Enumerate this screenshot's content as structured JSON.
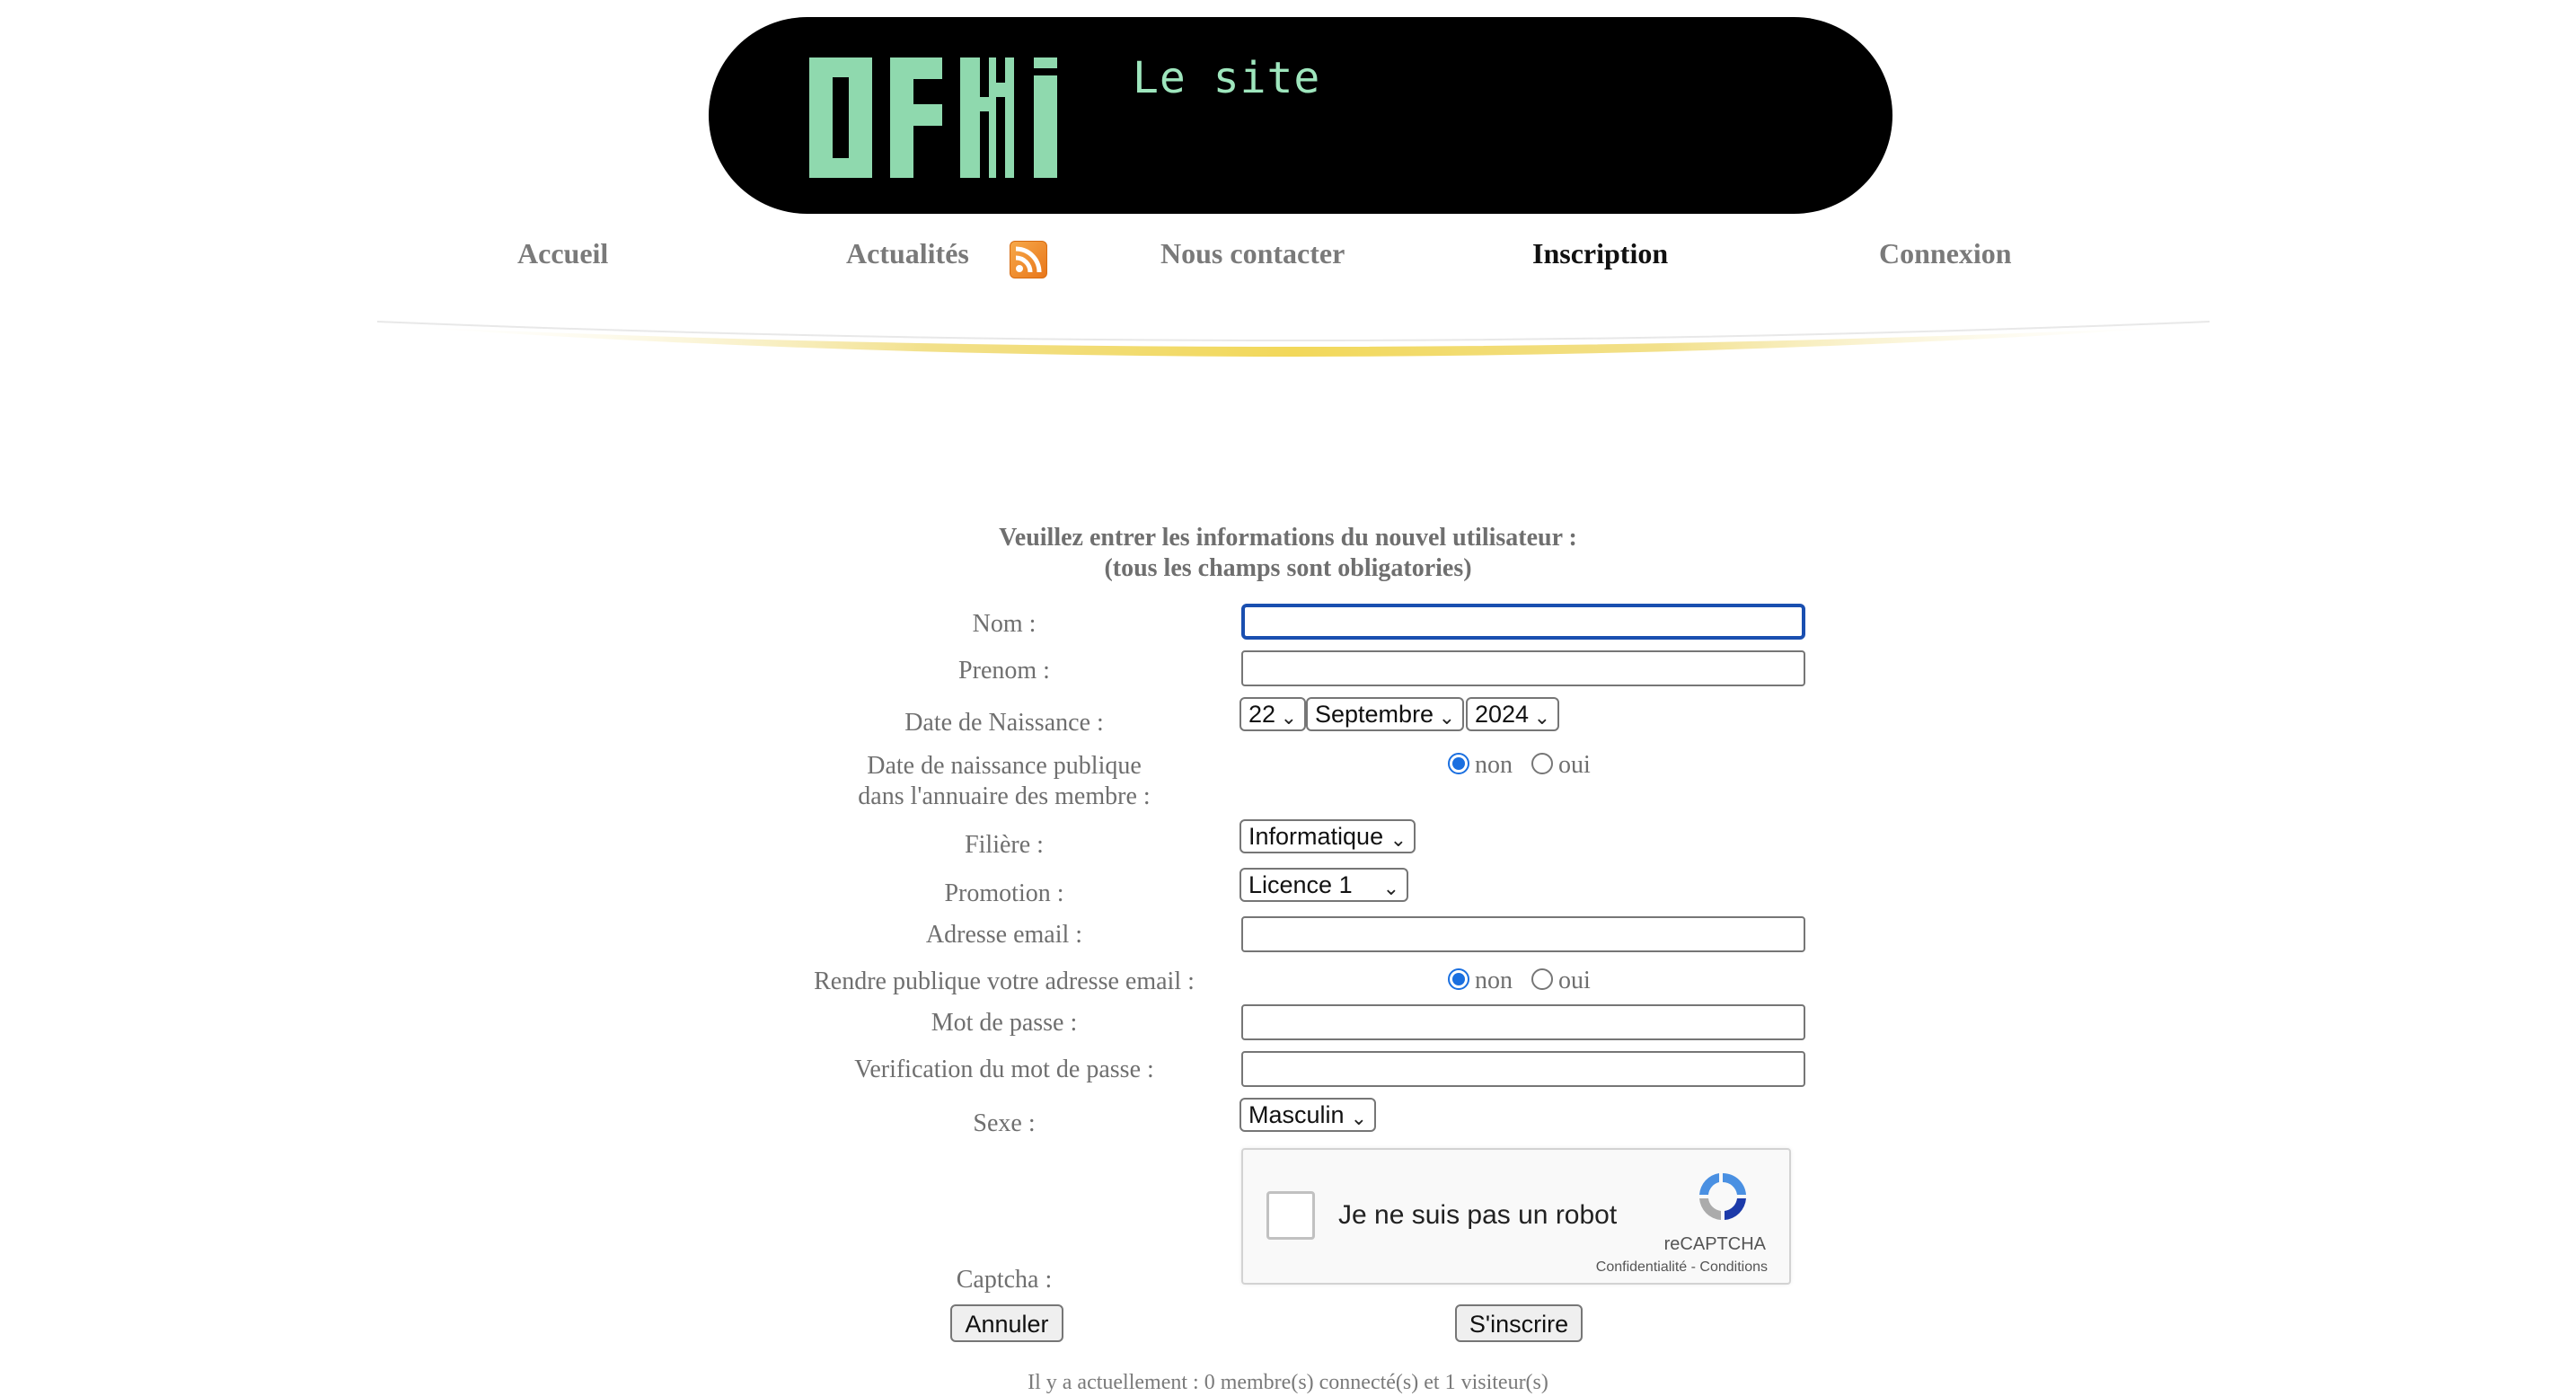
{
  "header": {
    "logo_text": "OFNi",
    "tagline": "Le site",
    "logo_color": "#8fd9ae"
  },
  "nav": {
    "items": [
      {
        "label": "Accueil"
      },
      {
        "label": "Actualités"
      },
      {
        "label": "Nous contacter"
      },
      {
        "label": "Inscription"
      },
      {
        "label": "Connexion"
      }
    ],
    "active": "Inscription",
    "feed_icon": "rss-icon"
  },
  "form": {
    "intro_line1": "Veuillez entrer les informations du nouvel utilisateur :",
    "intro_line2": "(tous les champs sont obligatories)",
    "labels": {
      "nom": "Nom :",
      "prenom": "Prenom :",
      "birthdate": "Date de Naissance :",
      "birthdate_public_1": "Date de naissance publique",
      "birthdate_public_2": "dans l'annuaire des membre :",
      "filiere": "Filière :",
      "promotion": "Promotion :",
      "email": "Adresse email :",
      "email_public": "Rendre publique votre adresse email :",
      "password": "Mot de passe :",
      "password_confirm": "Verification du mot de passe :",
      "sexe": "Sexe :",
      "captcha": "Captcha :"
    },
    "values": {
      "nom": "",
      "prenom": "",
      "email": "",
      "password": "",
      "password_confirm": ""
    },
    "birth_day": "22",
    "birth_month": "Septembre",
    "birth_year": "2024",
    "filiere": "Informatique",
    "promotion": "Licence 1",
    "sexe": "Masculin",
    "radio_no": "non",
    "radio_yes": "oui",
    "birthdate_public_selected": "non",
    "email_public_selected": "non"
  },
  "captcha": {
    "text": "Je ne suis pas un robot",
    "brand": "reCAPTCHA",
    "privacy": "Confidentialité",
    "separator": " - ",
    "terms": "Conditions"
  },
  "buttons": {
    "cancel": "Annuler",
    "submit": "S'inscrire"
  },
  "footer": {
    "online": "Il y a actuellement : 0 membre(s) connecté(s) et 1 visiteur(s)"
  },
  "colors": {
    "focus_border": "#1a4fb0",
    "radio_checked": "#1a6fe0",
    "swoosh": "#f2d85a"
  }
}
